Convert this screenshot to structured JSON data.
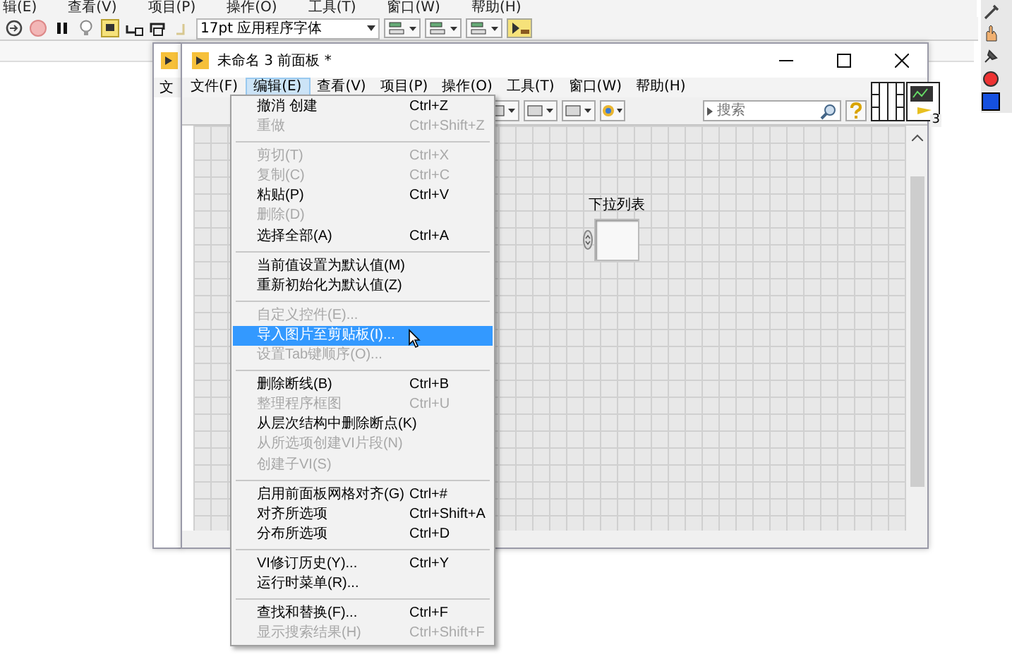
{
  "app": {
    "menu": [
      "辑(E)",
      "查看(V)",
      "项目(P)",
      "操作(O)",
      "工具(T)",
      "窗口(W)",
      "帮助(H)"
    ],
    "font_dropdown": "17pt 应用程序字体"
  },
  "back_window": {
    "menu_label": "文"
  },
  "window": {
    "title": "未命名 3 前面板 *",
    "menu": [
      {
        "label": "文件(F)",
        "selected": false
      },
      {
        "label": "编辑(E)",
        "selected": true
      },
      {
        "label": "查看(V)",
        "selected": false
      },
      {
        "label": "项目(P)",
        "selected": false
      },
      {
        "label": "操作(O)",
        "selected": false
      },
      {
        "label": "工具(T)",
        "selected": false
      },
      {
        "label": "窗口(W)",
        "selected": false
      },
      {
        "label": "帮助(H)",
        "selected": false
      }
    ],
    "search": {
      "placeholder": "搜索"
    },
    "connector_number": "3",
    "control": {
      "label": "下拉列表"
    }
  },
  "edit_menu": [
    {
      "kind": "item",
      "label": "撤消 创建",
      "shortcut": "Ctrl+Z",
      "disabled": false,
      "selected": false
    },
    {
      "kind": "item",
      "label": "重做",
      "shortcut": "Ctrl+Shift+Z",
      "disabled": true,
      "selected": false
    },
    {
      "kind": "separator"
    },
    {
      "kind": "item",
      "label": "剪切(T)",
      "shortcut": "Ctrl+X",
      "disabled": true,
      "selected": false
    },
    {
      "kind": "item",
      "label": "复制(C)",
      "shortcut": "Ctrl+C",
      "disabled": true,
      "selected": false
    },
    {
      "kind": "item",
      "label": "粘贴(P)",
      "shortcut": "Ctrl+V",
      "disabled": false,
      "selected": false
    },
    {
      "kind": "item",
      "label": "删除(D)",
      "disabled": true,
      "selected": false
    },
    {
      "kind": "item",
      "label": "选择全部(A)",
      "shortcut": "Ctrl+A",
      "disabled": false,
      "selected": false
    },
    {
      "kind": "separator"
    },
    {
      "kind": "item",
      "label": "当前值设置为默认值(M)",
      "disabled": false,
      "selected": false
    },
    {
      "kind": "item",
      "label": "重新初始化为默认值(Z)",
      "disabled": false,
      "selected": false
    },
    {
      "kind": "separator"
    },
    {
      "kind": "item",
      "label": "自定义控件(E)...",
      "disabled": true,
      "selected": false
    },
    {
      "kind": "item",
      "label": "导入图片至剪贴板(I)...",
      "disabled": false,
      "selected": true
    },
    {
      "kind": "item",
      "label": "设置Tab键顺序(O)...",
      "disabled": true,
      "selected": false
    },
    {
      "kind": "separator"
    },
    {
      "kind": "item",
      "label": "删除断线(B)",
      "shortcut": "Ctrl+B",
      "disabled": false,
      "selected": false
    },
    {
      "kind": "item",
      "label": "整理程序框图",
      "shortcut": "Ctrl+U",
      "disabled": true,
      "selected": false
    },
    {
      "kind": "item",
      "label": "从层次结构中删除断点(K)",
      "disabled": false,
      "selected": false
    },
    {
      "kind": "item",
      "label": "从所选项创建VI片段(N)",
      "disabled": true,
      "selected": false
    },
    {
      "kind": "item",
      "label": "创建子VI(S)",
      "disabled": true,
      "selected": false
    },
    {
      "kind": "separator"
    },
    {
      "kind": "item",
      "label": "启用前面板网格对齐(G)",
      "shortcut": "Ctrl+#",
      "disabled": false,
      "selected": false
    },
    {
      "kind": "item",
      "label": "对齐所选项",
      "shortcut": "Ctrl+Shift+A",
      "disabled": false,
      "selected": false
    },
    {
      "kind": "item",
      "label": "分布所选项",
      "shortcut": "Ctrl+D",
      "disabled": false,
      "selected": false
    },
    {
      "kind": "separator"
    },
    {
      "kind": "item",
      "label": "VI修订历史(Y)...",
      "shortcut": "Ctrl+Y",
      "disabled": false,
      "selected": false
    },
    {
      "kind": "item",
      "label": "运行时菜单(R)...",
      "disabled": false,
      "selected": false
    },
    {
      "kind": "separator"
    },
    {
      "kind": "item",
      "label": "查找和替换(F)...",
      "shortcut": "Ctrl+F",
      "disabled": false,
      "selected": false
    },
    {
      "kind": "item",
      "label": "显示搜索结果(H)",
      "shortcut": "Ctrl+Shift+F",
      "disabled": true,
      "selected": false
    }
  ]
}
